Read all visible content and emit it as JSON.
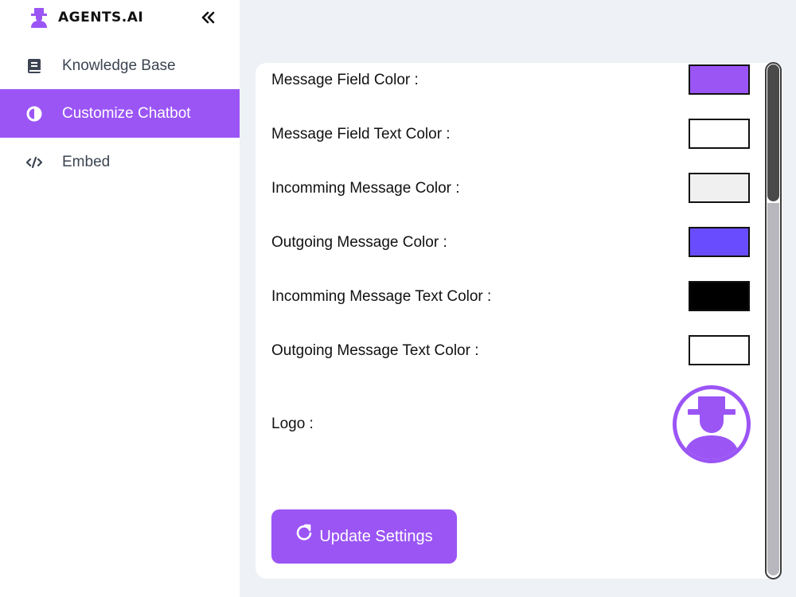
{
  "brand": {
    "name": "AGENTS.AI",
    "icon": "agent-hat-icon",
    "accent": "#9b55f5"
  },
  "sidebar": {
    "collapse_icon": "double-chevron-left-icon",
    "items": [
      {
        "label": "Knowledge Base",
        "icon": "book-icon",
        "active": false
      },
      {
        "label": "Customize Chatbot",
        "icon": "contrast-icon",
        "active": true
      },
      {
        "label": "Embed",
        "icon": "code-icon",
        "active": false
      }
    ]
  },
  "settings": {
    "rows": [
      {
        "label": "Message Field Color :",
        "color": "#9b55f5"
      },
      {
        "label": "Message Field Text Color :",
        "color": "#ffffff"
      },
      {
        "label": "Incomming Message Color :",
        "color": "#f0f0f0"
      },
      {
        "label": "Outgoing Message Color :",
        "color": "#6a4cff"
      },
      {
        "label": "Incomming Message Text Color :",
        "color": "#000000"
      },
      {
        "label": "Outgoing Message Text Color :",
        "color": "#ffffff"
      }
    ],
    "logo_label": "Logo :",
    "logo_icon": "agent-avatar-icon",
    "update_button": {
      "label": "Update Settings",
      "icon": "refresh-icon"
    }
  }
}
